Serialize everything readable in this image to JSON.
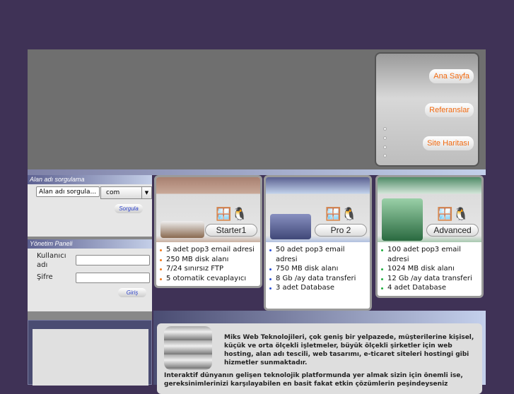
{
  "nav": {
    "items": [
      "Ana Sayfa",
      "Referanslar",
      "Site Haritası"
    ]
  },
  "domain_search": {
    "title": "Alan adı sorgulama",
    "input_value": "Alan adı sorgula...",
    "tld_selected": "com",
    "button": "Sorgula"
  },
  "admin_panel": {
    "title": "Yönetim Paneli",
    "username_label": "Kullanıcı adı",
    "password_label": "Şifre",
    "button": "Giriş"
  },
  "plans": [
    {
      "name": "Starter1",
      "bullet_color": "#f07a20",
      "features": [
        "5 adet pop3 email adresi",
        "250 MB disk alanı",
        "7/24 sınırsız FTP",
        "5 otomatik cevaplayıcı"
      ]
    },
    {
      "name": "Pro 2",
      "bullet_color": "#2a4fd8",
      "features": [
        "50 adet pop3 email adresi",
        "750 MB disk alanı",
        "8 Gb /ay data transferi",
        "3 adet Database"
      ]
    },
    {
      "name": "Advanced",
      "bullet_color": "#20b040",
      "features": [
        "100 adet pop3 email adresi",
        "1024 MB disk alanı",
        "12 Gb /ay data transferi",
        "4 adet Database"
      ]
    }
  ],
  "about": {
    "p1": "Miks Web Teknolojileri, çok geniş bir yelpazede, müşterilerine kişisel, küçük ve orta ölçekli işletmeler, büyük ölçekli şirketler için web hosting, alan adı tescili, web tasarımı, e-ticaret siteleri hostingi gibi hizmetler sunmaktadır.",
    "p2": "Interaktif dünyanın gelişen teknolojik platformunda yer almak sizin için önemli ise, gereksinimlerinizi karşılayabilen en basit fakat etkin çözümlerin peşindeyseniz"
  }
}
